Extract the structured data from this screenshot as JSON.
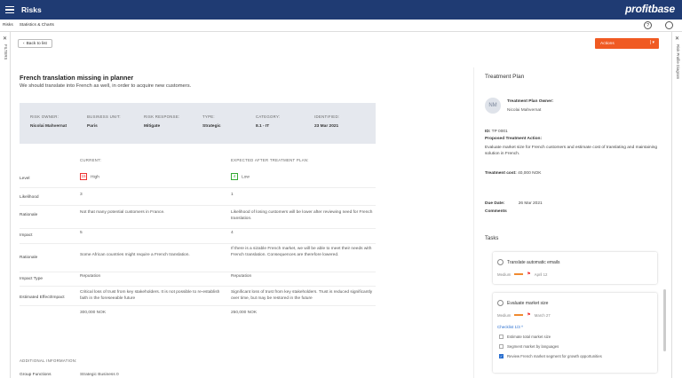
{
  "app": {
    "title": "Risks",
    "logo": "profitbase"
  },
  "breadcrumb": {
    "root": "Risks",
    "current": "Statistics & Charts"
  },
  "left_rail": {
    "label": "FILTERS"
  },
  "right_rail": {
    "label": "Risk Profile Diagram"
  },
  "toolbar": {
    "back_label": "Back to list",
    "actions_label": "Actions"
  },
  "risk": {
    "title": "French translation missing in planner",
    "description": "We should translate into French as well, in order to acquire new customers."
  },
  "summary": [
    {
      "label": "RISK OWNER:",
      "value": "Nicolai Mahvernat"
    },
    {
      "label": "BUSINESS UNIT:",
      "value": "Paris"
    },
    {
      "label": "RISK RESPONSE:",
      "value": "Mitigate"
    },
    {
      "label": "TYPE:",
      "value": "Strategic"
    },
    {
      "label": "CATEGORY:",
      "value": "8.1 - IT"
    },
    {
      "label": "IDENTIFIED:",
      "value": "23 Mar 2021"
    }
  ],
  "table": {
    "header_current": "CURRENT:",
    "header_expected": "EXPECTED AFTER TREATMENT PLAN:",
    "level": {
      "label": "Level",
      "current_badge": "15",
      "current_text": "High",
      "expected_badge": "4",
      "expected_text": "Low"
    },
    "likelihood": {
      "label": "Likelihood",
      "current": "3",
      "expected": "1"
    },
    "rationale1": {
      "label": "Rationale",
      "current": "Not that many potential customers in France.",
      "expected": "Likelihood of losing customers will be lower after reviewing need for French translation."
    },
    "impact": {
      "label": "Impact",
      "current": "5",
      "expected": "4"
    },
    "rationale2": {
      "label": "Rationale",
      "current": "Some African countries might require a French translation.",
      "expected": "If there is a sizable French market, we will be able to meet their needs with French translation. Consequences are therefore lowered."
    },
    "impact_type": {
      "label": "Impact Type",
      "current": "Reputation",
      "expected": "Reputation"
    },
    "effect": {
      "label": "Estimated Effect/Impact",
      "current": "Critical loss of trust from key stakeholders. It is not possible to re-establish faith in the foreseeable future",
      "expected": "Significant loss of trust from key stakeholders. Trust is reduced significantly over time, but may be restored in the future"
    },
    "amount": {
      "current": "300,000 NOK",
      "expected": "250,000 NOK"
    }
  },
  "additional": {
    "title": "ADDITIONAL INFORMATION:",
    "group_label": "Group Functions",
    "group_value": "Strategic Business 0"
  },
  "treatment": {
    "title": "Treatment Plan",
    "avatar_initials": "NM",
    "owner_label": "Treatment Plan Owner:",
    "owner_name": "Nicolai Mahvernat",
    "id_label": "ID:",
    "id_value": "TP 0001",
    "action_label": "Proposed Treatment Action:",
    "action_text": "Evaluate market size for French customers and estimate cost of translating and maintaining solution in French.",
    "cost_label": "Treatment cost:",
    "cost_value": "40,000 NOK",
    "due_label": "Due Date:",
    "due_value": "26 Mar 2021",
    "comments_label": "Comments"
  },
  "tasks": {
    "title": "Tasks",
    "items": [
      {
        "name": "Translate automatic emails",
        "priority": "Medium",
        "date": "April 12"
      },
      {
        "name": "Evaluate market size",
        "priority": "Medium",
        "date": "March 27",
        "checklist_label": "Checklist 1/3",
        "checklist": [
          {
            "text": "Estimate total market size",
            "checked": false
          },
          {
            "text": "Segment market by languages",
            "checked": false
          },
          {
            "text": "Review French market segment for growth opportunities",
            "checked": true
          }
        ]
      }
    ]
  },
  "colors": {
    "topbar": "#1f3b73",
    "actions": "#f05a22",
    "high": "#ee3333",
    "low": "#33aa33"
  }
}
